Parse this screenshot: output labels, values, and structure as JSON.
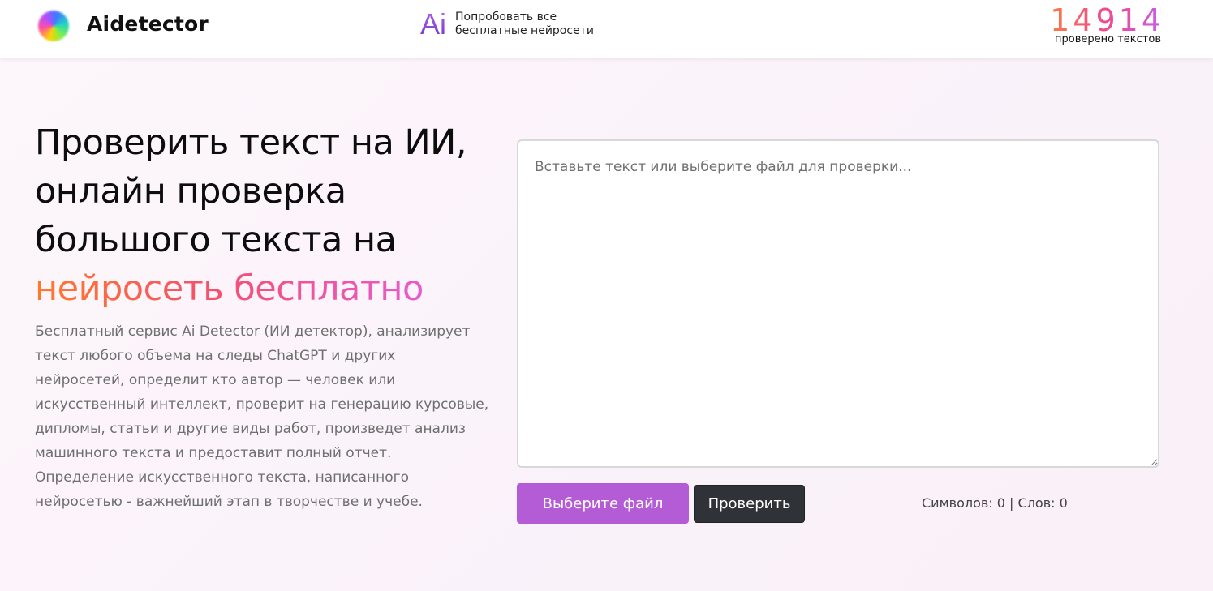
{
  "header": {
    "logo_text": "Aidetector",
    "try_mark": "Ai",
    "try_line1": "Попробовать все",
    "try_line2": "бесплатные нейросети",
    "counter_value": "14914",
    "counter_label": "проверено текстов"
  },
  "hero": {
    "title_line1": "Проверить текст на ИИ,",
    "title_line2": "онлайн проверка",
    "title_line3": "большого текста на",
    "title_accent": "нейросеть бесплатно",
    "description": "Бесплатный сервис Ai Detector (ИИ детектор), анализирует текст любого объема на следы ChatGPT и других нейросетей, определит кто автор — человек или искусственный интеллект, проверит на генерацию курсовые, дипломы, статьи и другие виды работ, произведет анализ машинного текста и предоставит полный отчет. Определение искусственного текста, написанного нейросетью - важнейший этап в творчестве и учебе."
  },
  "checker": {
    "textarea_value": "",
    "textarea_placeholder": "Вставьте текст или выберите файл для проверки...",
    "file_button_label": "Выберите файл",
    "check_button_label": "Проверить",
    "stats_text": "Символов: 0 | Слов: 0"
  },
  "colors": {
    "accent_purple": "#b45bd6",
    "dark_button": "#2f3338",
    "gradient_orange": "#ff7a2a",
    "gradient_pink": "#f5506d",
    "gradient_violet": "#e65bd0"
  }
}
